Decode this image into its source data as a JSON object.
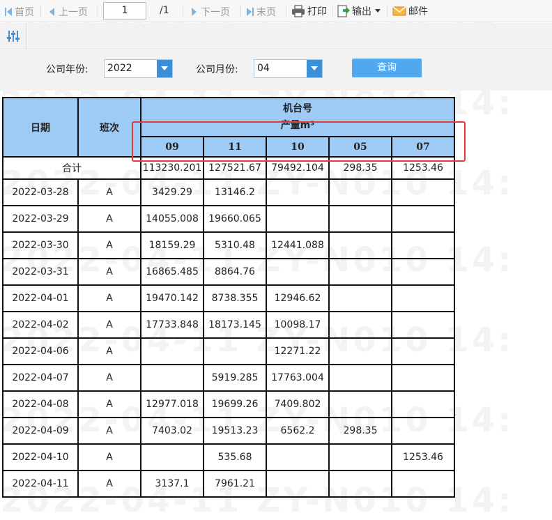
{
  "toolbar": {
    "first_label": "首页",
    "prev_label": "上一页",
    "page_input_value": "1",
    "page_total": "/1",
    "next_label": "下一页",
    "last_label": "末页",
    "print_label": "打印",
    "export_label": "输出",
    "mail_label": "邮件"
  },
  "params": {
    "year_label": "公司年份:",
    "year_value": "2022",
    "month_label": "公司月份:",
    "month_value": "04",
    "query_label": "查询"
  },
  "watermark": {
    "text": "2022-04-11 ZY-N010 14:"
  },
  "table": {
    "date_header": "日期",
    "shift_header": "班次",
    "machine_header": "机台号",
    "output_header": "产量m³",
    "machines": [
      "09",
      "11",
      "10",
      "05",
      "07"
    ],
    "total_label": "合计",
    "totals": [
      "113230.201",
      "127521.67",
      "79492.104",
      "298.35",
      "1253.46"
    ],
    "rows": [
      {
        "date": "2022-03-28",
        "shift": "A",
        "values": [
          "3429.29",
          "13146.2",
          "",
          "",
          ""
        ]
      },
      {
        "date": "2022-03-29",
        "shift": "A",
        "values": [
          "14055.008",
          "19660.065",
          "",
          "",
          ""
        ]
      },
      {
        "date": "2022-03-30",
        "shift": "A",
        "values": [
          "18159.29",
          "5310.48",
          "12441.088",
          "",
          ""
        ]
      },
      {
        "date": "2022-03-31",
        "shift": "A",
        "values": [
          "16865.485",
          "8864.76",
          "",
          "",
          ""
        ]
      },
      {
        "date": "2022-04-01",
        "shift": "A",
        "values": [
          "19470.142",
          "8738.355",
          "12946.62",
          "",
          ""
        ]
      },
      {
        "date": "2022-04-02",
        "shift": "A",
        "values": [
          "17733.848",
          "18173.145",
          "10098.17",
          "",
          ""
        ]
      },
      {
        "date": "2022-04-06",
        "shift": "A",
        "values": [
          "",
          "",
          "12271.22",
          "",
          ""
        ]
      },
      {
        "date": "2022-04-07",
        "shift": "A",
        "values": [
          "",
          "5919.285",
          "17763.004",
          "",
          ""
        ]
      },
      {
        "date": "2022-04-08",
        "shift": "A",
        "values": [
          "12977.018",
          "19699.26",
          "7409.802",
          "",
          ""
        ]
      },
      {
        "date": "2022-04-09",
        "shift": "A",
        "values": [
          "7403.02",
          "19513.23",
          "6562.2",
          "298.35",
          ""
        ]
      },
      {
        "date": "2022-04-10",
        "shift": "A",
        "values": [
          "",
          "535.68",
          "",
          "",
          "1253.46"
        ]
      },
      {
        "date": "2022-04-11",
        "shift": "A",
        "values": [
          "3137.1",
          "7961.21",
          "",
          "",
          ""
        ]
      }
    ]
  },
  "colors": {
    "header_bg": "#9ecbf6",
    "highlight": "#e23b3b",
    "query_button": "#52a8ee",
    "combo_arrow": "#3a8fd8"
  }
}
